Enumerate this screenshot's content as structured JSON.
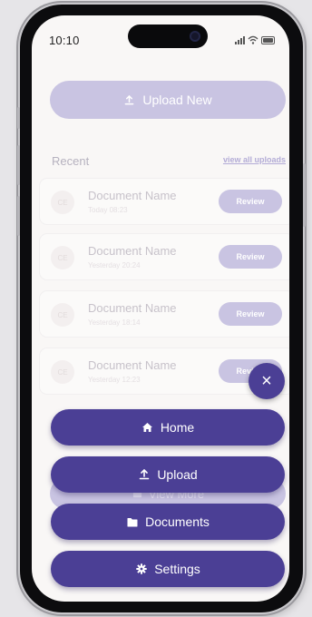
{
  "status_bar": {
    "time": "10:10"
  },
  "upload_new": {
    "label": "Upload New",
    "icon": "upload-icon"
  },
  "recent": {
    "label": "Recent",
    "view_all": "view all uploads"
  },
  "documents": [
    {
      "initials": "CE",
      "name": "Document Name",
      "date": "Today 08:23",
      "action": "Review"
    },
    {
      "initials": "CE",
      "name": "Document Name",
      "date": "Yesterday 20:24",
      "action": "Review"
    },
    {
      "initials": "CE",
      "name": "Document Name",
      "date": "Yesterday 18:14",
      "action": "Review"
    },
    {
      "initials": "CE",
      "name": "Document Name",
      "date": "Yesterday 12:23",
      "action": "Review"
    }
  ],
  "view_more": {
    "label": "View More"
  },
  "fab": {
    "icon": "close-icon",
    "glyph": "×"
  },
  "menu": {
    "home": {
      "label": "Home",
      "icon": "home-icon"
    },
    "upload": {
      "label": "Upload",
      "icon": "upload-icon"
    },
    "documents": {
      "label": "Documents",
      "icon": "folder-icon"
    },
    "settings": {
      "label": "Settings",
      "icon": "gear-icon"
    }
  },
  "colors": {
    "primary": "#4b3f95",
    "primary_light": "#c9c4e2",
    "screen_bg": "#f9f7f6"
  }
}
